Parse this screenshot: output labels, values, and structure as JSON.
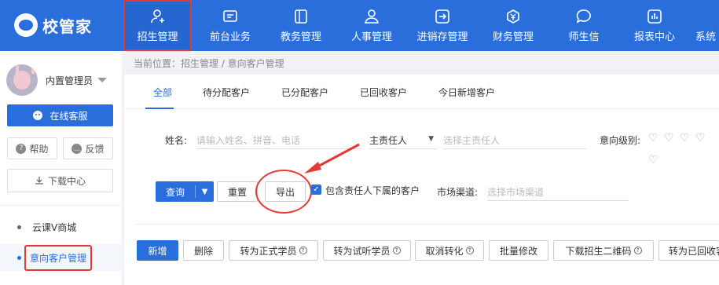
{
  "app": {
    "logo_text": "校管家"
  },
  "topnav": [
    {
      "label": "招生管理",
      "icon": "user-add-icon"
    },
    {
      "label": "前台业务",
      "icon": "monitor-icon"
    },
    {
      "label": "教务管理",
      "icon": "book-icon"
    },
    {
      "label": "人事管理",
      "icon": "person-icon"
    },
    {
      "label": "进销存管理",
      "icon": "inout-icon"
    },
    {
      "label": "财务管理",
      "icon": "money-icon"
    },
    {
      "label": "师生信",
      "icon": "chat-icon"
    },
    {
      "label": "报表中心",
      "icon": "chart-icon"
    },
    {
      "label": "系统",
      "icon": "settings-icon"
    }
  ],
  "sidebar": {
    "admin_name": "内置管理员",
    "online_service": "在线客服",
    "help": "帮助",
    "feedback": "反馈",
    "download": "下载中心",
    "items": [
      {
        "label": "云课V商城"
      },
      {
        "label": "意向客户管理"
      }
    ]
  },
  "breadcrumb": "当前位置：招生管理 / 意向客户管理",
  "tabs": [
    "全部",
    "待分配客户",
    "已分配客户",
    "已回收客户",
    "今日新增客户"
  ],
  "filters": {
    "name_label": "姓名:",
    "name_placeholder": "请输入姓名、拼音、电话",
    "owner_select": "主责任人",
    "owner_placeholder": "选择主责任人",
    "level_label": "意向级别:",
    "channel_label": "市场渠道:",
    "channel_placeholder": "选择市场渠道",
    "include_sub": "包含责任人下属的客户",
    "include_sub_checked": true
  },
  "buttons": {
    "query": "查询",
    "reset": "重置",
    "export": "导出"
  },
  "actions": [
    "新增",
    "删除",
    "转为正式学员",
    "转为试听学员",
    "取消转化",
    "批量修改",
    "下载招生二维码",
    "转为已回收客户"
  ],
  "colors": {
    "primary": "#2a6edb",
    "highlight": "#e53935"
  }
}
